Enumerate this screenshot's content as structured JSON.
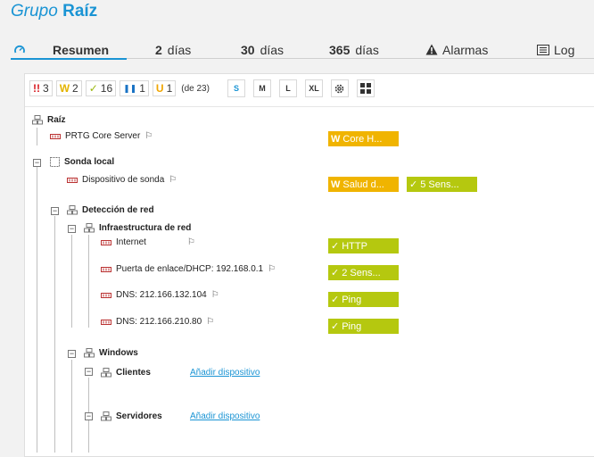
{
  "header": {
    "title_prefix": "Grupo",
    "title_name": "Raíz"
  },
  "tabs": {
    "overview": "Resumen",
    "d2_num": "2",
    "d2_unit": "días",
    "d30_num": "30",
    "d30_unit": "días",
    "d365_num": "365",
    "d365_unit": "días",
    "alarms": "Alarmas",
    "log": "Log"
  },
  "toolbar": {
    "down_glyph": "!!",
    "down_count": "3",
    "warn_glyph": "W",
    "warn_count": "2",
    "ok_glyph": "✓",
    "ok_count": "16",
    "paused_glyph": "❚❚",
    "paused_count": "1",
    "unusual_glyph": "U",
    "unusual_count": "1",
    "total": "(de 23)",
    "sizes": [
      "S",
      "M",
      "L",
      "XL"
    ]
  },
  "tree": {
    "root": "Raíz",
    "core_server": "PRTG Core Server",
    "probe": "Sonda local",
    "probe_device": "Dispositivo de sonda",
    "discovery": "Detección de red",
    "infra": "Infraestructura de red",
    "internet": "Internet",
    "gateway": "Puerta de enlace/DHCP: 192.168.0.1",
    "dns1": "DNS: 212.166.132.104",
    "dns2": "DNS: 212.166.210.80",
    "windows": "Windows",
    "clients": "Clientes",
    "servers": "Servidores",
    "add_device": "Añadir dispositivo"
  },
  "sensors": {
    "core_health": "Core H...",
    "probe_health": "Salud d...",
    "probe_sensors": "5 Sens...",
    "http": "HTTP",
    "gateway_sensors": "2 Sens...",
    "dns1_ping": "Ping",
    "dns2_ping": "Ping"
  },
  "colors": {
    "accent": "#1a94d4",
    "warning": "#f0b400",
    "ok": "#b5c80f",
    "down": "#d71920"
  }
}
